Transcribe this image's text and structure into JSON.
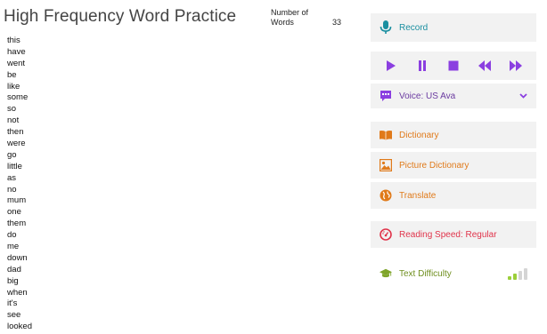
{
  "header": {
    "title": "High Frequency Word Practice",
    "count_label": "Number of Words",
    "count_value": "33"
  },
  "words": [
    "this",
    "have",
    "went",
    "be",
    "like",
    "some",
    "so",
    "not",
    "then",
    "were",
    "go",
    "little",
    "as",
    "no",
    "mum",
    "one",
    "them",
    "do",
    "me",
    "down",
    "dad",
    "big",
    "when",
    "it's",
    "see",
    "looked"
  ],
  "toolbar": {
    "record_label": "Record",
    "transport_buttons": [
      "play",
      "pause",
      "stop",
      "rewind",
      "fast-forward"
    ],
    "voice_label": "Voice: US Ava",
    "dictionary_label": "Dictionary",
    "picture_dictionary_label": "Picture Dictionary",
    "translate_label": "Translate",
    "reading_speed_label": "Reading Speed: Regular",
    "text_difficulty_label": "Text Difficulty",
    "text_difficulty_level": 2,
    "text_difficulty_levels": 4
  },
  "colors": {
    "record": "#1a8fa0",
    "transport": "#8b3fe0",
    "voice": "#6a3aa0",
    "tools": "#e07a1a",
    "reading_speed": "#e0334a",
    "difficulty": "#6f8f1f",
    "difficulty_active": "#9bcf3a",
    "difficulty_inactive": "#d5d5d5"
  },
  "icons": {
    "record": "microphone-icon",
    "voice": "speech-bubble-icon",
    "voice_expand": "chevron-down-icon",
    "dictionary": "book-icon",
    "picture_dictionary": "picture-icon",
    "translate": "globe-icon",
    "reading_speed": "speedometer-icon",
    "text_difficulty": "graduation-cap-icon"
  }
}
